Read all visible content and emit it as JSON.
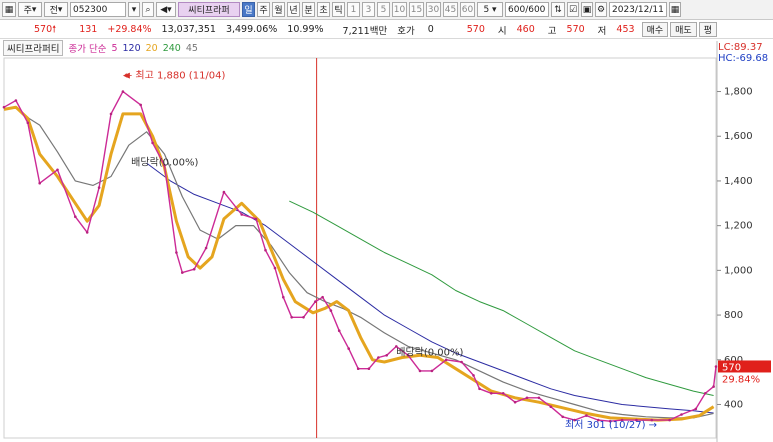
{
  "toolbar": {
    "market_select": "주",
    "type_select": "전",
    "code": "052300",
    "name": "씨티프라퍼",
    "periods": [
      "일",
      "주",
      "월",
      "년",
      "분",
      "초",
      "틱"
    ],
    "active_period": "일",
    "intervals": [
      "1",
      "3",
      "5",
      "10",
      "15",
      "30",
      "45",
      "60"
    ],
    "step_value": "5",
    "count": "600",
    "count_total": "/600",
    "date": "2023/12/11"
  },
  "quote": {
    "price": "570",
    "change": "131",
    "change_pct": "+29.84%",
    "volume": "13,037,351",
    "volume_pct": "3,499.06%",
    "turnover_pct": "10.99%",
    "amount": "7,211백만",
    "hoga_label": "호가",
    "hoga_value": "0",
    "hoga_price": "570",
    "open_label": "시",
    "open": "460",
    "high_label": "고",
    "high": "570",
    "low_label": "저",
    "low": "453",
    "buy_button": "매수",
    "sell_button": "매도",
    "eval_button": "평"
  },
  "legend": {
    "title": "씨티프라퍼티",
    "ma_label": "종가 단순",
    "periods": [
      "5",
      "120",
      "20",
      "240",
      "45"
    ],
    "colors": {
      "price": "#cc2a96",
      "ma5": "#cc2a96",
      "ma20": "#e5a51f",
      "ma45": "#777777",
      "ma120": "#2c2ca3",
      "ma240": "#2f9a3e"
    }
  },
  "right_labels": {
    "lc": "LC:89.37",
    "hc": "HC:-69.68",
    "last_price": "570",
    "last_pct": "29.84%"
  },
  "annotations": {
    "high": "최고 1,880 (11/04)",
    "low": "최저 301 (10/27)",
    "dividend1": "배당락(0.00%)",
    "dividend2": "배당락(0.00%)"
  },
  "chart_data": {
    "type": "line",
    "title": "씨티프라퍼티",
    "ylim": [
      250,
      1950
    ],
    "yticks": [
      400,
      600,
      800,
      1000,
      1200,
      1400,
      1600,
      1800
    ],
    "ytick_labels": [
      "400",
      "600",
      "800",
      "1,000",
      "1,200",
      "1,400",
      "1,600",
      "1,800"
    ],
    "x_count": 600,
    "series": [
      {
        "name": "5",
        "key": "price",
        "x": [
          0,
          10,
          20,
          30,
          45,
          60,
          70,
          80,
          90,
          100,
          115,
          125,
          135,
          145,
          150,
          160,
          170,
          185,
          200,
          212,
          220,
          228,
          235,
          242,
          252,
          262,
          268,
          275,
          282,
          290,
          298,
          307,
          315,
          322,
          330,
          340,
          350,
          360,
          372,
          385,
          395,
          400,
          410,
          420,
          430,
          440,
          450,
          460,
          470,
          480,
          490,
          500,
          510,
          520,
          532,
          545,
          560,
          570,
          582,
          590,
          597,
          599
        ],
        "values": [
          1730,
          1760,
          1660,
          1390,
          1450,
          1240,
          1170,
          1370,
          1700,
          1800,
          1740,
          1570,
          1470,
          1080,
          990,
          1005,
          1100,
          1350,
          1250,
          1230,
          1090,
          1010,
          880,
          790,
          790,
          860,
          880,
          820,
          730,
          650,
          560,
          560,
          610,
          620,
          660,
          620,
          550,
          550,
          600,
          590,
          530,
          470,
          450,
          450,
          410,
          430,
          430,
          390,
          345,
          330,
          350,
          330,
          325,
          330,
          330,
          330,
          330,
          355,
          380,
          450,
          480,
          570
        ]
      },
      {
        "name": "20",
        "key": "ma20",
        "x": [
          0,
          10,
          20,
          30,
          45,
          60,
          70,
          80,
          90,
          100,
          115,
          125,
          135,
          145,
          155,
          165,
          175,
          185,
          200,
          215,
          225,
          235,
          245,
          260,
          270,
          280,
          290,
          300,
          310,
          320,
          335,
          350,
          365,
          380,
          395,
          410,
          430,
          450,
          470,
          490,
          510,
          530,
          550,
          570,
          585,
          597
        ],
        "values": [
          1720,
          1730,
          1680,
          1520,
          1420,
          1300,
          1220,
          1290,
          1520,
          1700,
          1700,
          1600,
          1460,
          1220,
          1060,
          1010,
          1060,
          1230,
          1300,
          1220,
          1090,
          960,
          860,
          810,
          830,
          860,
          820,
          700,
          600,
          590,
          610,
          620,
          610,
          560,
          510,
          460,
          430,
          410,
          385,
          360,
          340,
          335,
          330,
          335,
          350,
          390
        ]
      },
      {
        "name": "45",
        "key": "ma45",
        "x": [
          15,
          30,
          45,
          60,
          75,
          90,
          105,
          120,
          135,
          150,
          165,
          180,
          195,
          210,
          225,
          240,
          255,
          270,
          285,
          300,
          320,
          340,
          360,
          380,
          400,
          420,
          440,
          460,
          480,
          500,
          520,
          540,
          560,
          580,
          597
        ],
        "values": [
          1700,
          1650,
          1530,
          1400,
          1380,
          1420,
          1560,
          1620,
          1520,
          1330,
          1180,
          1140,
          1200,
          1200,
          1110,
          990,
          900,
          860,
          830,
          790,
          720,
          660,
          630,
          600,
          550,
          500,
          460,
          430,
          400,
          370,
          355,
          345,
          340,
          340,
          360
        ]
      },
      {
        "name": "120",
        "key": "ma120",
        "x": [
          120,
          140,
          160,
          180,
          200,
          220,
          240,
          260,
          280,
          300,
          320,
          340,
          360,
          380,
          400,
          420,
          440,
          460,
          480,
          500,
          520,
          540,
          560,
          580,
          597
        ],
        "values": [
          1480,
          1400,
          1340,
          1300,
          1260,
          1200,
          1120,
          1040,
          960,
          880,
          800,
          740,
          680,
          630,
          590,
          550,
          510,
          470,
          440,
          420,
          400,
          390,
          380,
          372,
          362
        ]
      },
      {
        "name": "240",
        "key": "ma240",
        "x": [
          240,
          260,
          280,
          300,
          320,
          340,
          360,
          380,
          400,
          420,
          440,
          460,
          480,
          500,
          520,
          540,
          560,
          580,
          597
        ],
        "values": [
          1310,
          1260,
          1200,
          1140,
          1080,
          1030,
          980,
          910,
          860,
          820,
          760,
          700,
          640,
          600,
          560,
          520,
          490,
          460,
          440
        ]
      }
    ]
  }
}
